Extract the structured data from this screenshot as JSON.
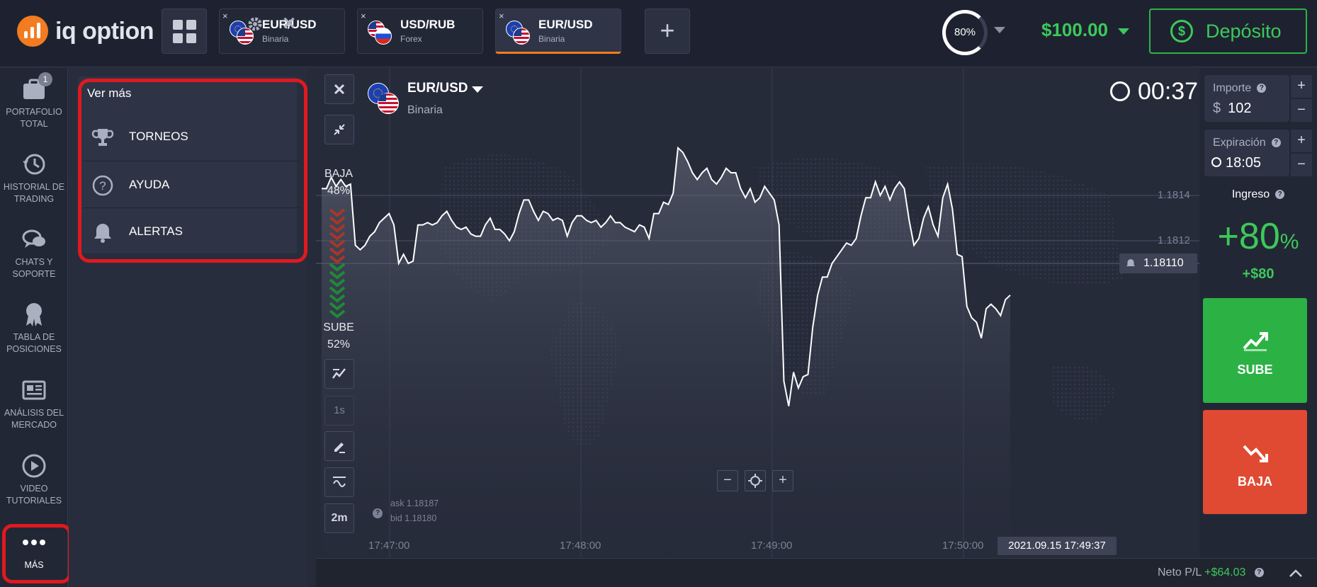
{
  "header": {
    "logo_text": "iq option",
    "tabs": [
      {
        "name": "EUR/USD",
        "type": "Binaria",
        "flags": [
          "eu",
          "us"
        ],
        "active": false
      },
      {
        "name": "USD/RUB",
        "type": "Forex",
        "flags": [
          "us",
          "ru"
        ],
        "active": false
      },
      {
        "name": "EUR/USD",
        "type": "Binaria",
        "flags": [
          "eu",
          "us"
        ],
        "active": true
      }
    ],
    "close_glyph": "×",
    "add_glyph": "+",
    "payout_pct": "80%",
    "balance": "$100.00",
    "deposit_label": "Depósito"
  },
  "sidebar": {
    "items": [
      {
        "label_1": "PORTAFOLIO",
        "label_2": "TOTAL",
        "icon": "briefcase-icon",
        "badge": "1"
      },
      {
        "label_1": "HISTORIAL DE",
        "label_2": "TRADING",
        "icon": "history-icon"
      },
      {
        "label_1": "CHATS Y",
        "label_2": "SOPORTE",
        "icon": "chat-icon"
      },
      {
        "label_1": "TABLA DE",
        "label_2": "POSICIONES",
        "icon": "award-icon"
      },
      {
        "label_1": "ANÁLISIS DEL",
        "label_2": "MERCADO",
        "icon": "newspaper-icon"
      },
      {
        "label_1": "VIDEO",
        "label_2": "TUTORIALES",
        "icon": "play-icon"
      },
      {
        "label_1": "MÁS",
        "label_2": "",
        "icon": "more-dots-icon"
      }
    ]
  },
  "more_panel": {
    "title": "Ver más",
    "items": [
      {
        "label": "TORNEOS",
        "icon": "trophy-icon"
      },
      {
        "label": "AYUDA",
        "icon": "help-icon"
      },
      {
        "label": "ALERTAS",
        "icon": "bell-icon"
      }
    ]
  },
  "chart": {
    "asset": "EUR/USD",
    "asset_type": "Binaria",
    "timer": "00:37",
    "sentiment_down_label": "BAJA",
    "sentiment_down_pct": "48%",
    "sentiment_up_label": "SUBE",
    "sentiment_up_pct": "52%",
    "timeframe_1": "1s",
    "timeframe_2": "2m",
    "ask": "ask 1.18187",
    "bid": "bid 1.18180",
    "price_levels": [
      "1.1814",
      "1.1812"
    ],
    "current_price": "1.18110",
    "x_ticks": [
      "17:47:00",
      "17:48:00",
      "17:49:00",
      "17:50:00"
    ],
    "current_time": "2021.09.15 17:49:37",
    "zoom_minus": "−",
    "zoom_plus": "+"
  },
  "chart_data": {
    "type": "line",
    "x_ticks": [
      "17:47:00",
      "17:48:00",
      "17:49:00",
      "17:50:00"
    ],
    "y_ticks": [
      1.1812,
      1.1814
    ],
    "current_price": 1.1811,
    "y": [
      1.18143,
      1.18143,
      1.18148,
      1.18144,
      1.18147,
      1.18144,
      1.18145,
      1.18118,
      1.18116,
      1.18118,
      1.18122,
      1.18124,
      1.18128,
      1.1813,
      1.18132,
      1.18127,
      1.1811,
      1.18114,
      1.1811,
      1.18111,
      1.18127,
      1.18127,
      1.18128,
      1.18127,
      1.18128,
      1.18131,
      1.18133,
      1.18129,
      1.18126,
      1.18125,
      1.18126,
      1.18123,
      1.18122,
      1.18122,
      1.18127,
      1.1813,
      1.18125,
      1.18125,
      1.18123,
      1.1812,
      1.18124,
      1.18132,
      1.18138,
      1.18138,
      1.18133,
      1.18129,
      1.18133,
      1.18132,
      1.18129,
      1.1813,
      1.18129,
      1.18122,
      1.18128,
      1.18131,
      1.18131,
      1.18129,
      1.18128,
      1.18129,
      1.18126,
      1.18128,
      1.18131,
      1.18128,
      1.18128,
      1.18126,
      1.18125,
      1.18124,
      1.18127,
      1.18126,
      1.18121,
      1.18132,
      1.18132,
      1.18137,
      1.18136,
      1.18141,
      1.18161,
      1.18159,
      1.18155,
      1.1815,
      1.18147,
      1.1815,
      1.18152,
      1.18147,
      1.18145,
      1.18148,
      1.18152,
      1.1815,
      1.1815,
      1.18143,
      1.18139,
      1.18143,
      1.18137,
      1.18139,
      1.18144,
      1.18141,
      1.18138,
      1.18127,
      1.18058,
      1.18047,
      1.18062,
      1.18055,
      1.1806,
      1.18061,
      1.18082,
      1.18096,
      1.18104,
      1.18104,
      1.1811,
      1.18113,
      1.18116,
      1.18119,
      1.18118,
      1.18121,
      1.18131,
      1.18139,
      1.18139,
      1.18146,
      1.1814,
      1.18144,
      1.18138,
      1.18143,
      1.18146,
      1.18143,
      1.18129,
      1.18118,
      1.18121,
      1.1813,
      1.18135,
      1.18127,
      1.18122,
      1.18139,
      1.18145,
      1.18134,
      1.18114,
      1.18113,
      1.18091,
      1.18086,
      1.18084,
      1.18077,
      1.1809,
      1.18092,
      1.1809,
      1.18087,
      1.18094,
      1.18096
    ]
  },
  "trade_panel": {
    "amount_label": "Importe",
    "amount_prefix": "$",
    "amount_value": "102",
    "expiry_label": "Expiración",
    "expiry_value": "18:05",
    "income_label": "Ingreso",
    "income_pct": "+80",
    "income_pct_sign": "%",
    "income_amount": "+$80",
    "up_label": "SUBE",
    "down_label": "BAJA",
    "plus": "+",
    "minus": "−"
  },
  "footer": {
    "net_label": "Neto P/L",
    "net_value": "+$64.03"
  },
  "colors": {
    "accent_orange": "#f37b20",
    "up_green": "#2cb244",
    "down_red": "#e04a32",
    "balance_green": "#3cc95a"
  }
}
